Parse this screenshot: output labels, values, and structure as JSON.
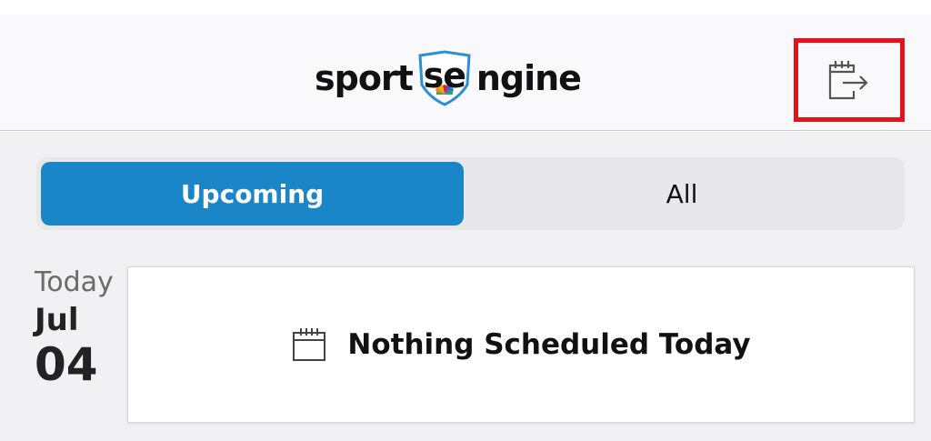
{
  "app": {
    "logo_left": "sport",
    "logo_shield": "se",
    "logo_right": "ngine"
  },
  "header": {
    "export_icon": "calendar-export-icon",
    "highlight_color": "#e4121b"
  },
  "tabs": [
    {
      "label": "Upcoming",
      "active": true
    },
    {
      "label": "All",
      "active": false
    }
  ],
  "date": {
    "relative": "Today",
    "month": "Jul",
    "day": "04"
  },
  "empty_state": {
    "icon": "calendar-icon",
    "message": "Nothing Scheduled Today"
  },
  "colors": {
    "accent": "#1a86c8",
    "header_bg": "#f9f9fb",
    "content_bg": "#f1f1f3"
  }
}
